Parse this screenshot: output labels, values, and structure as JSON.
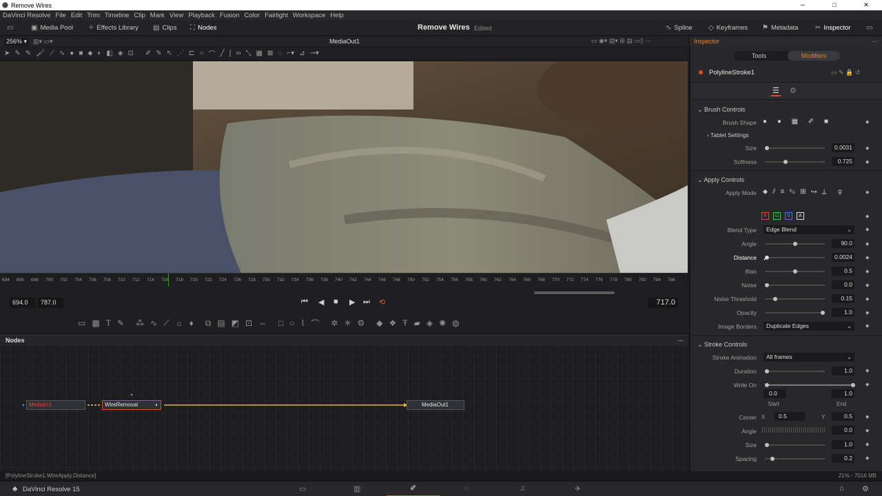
{
  "window": {
    "title": "Remove Wires",
    "controls": [
      "─",
      "□",
      "✕"
    ]
  },
  "menu": [
    "DaVinci Resolve",
    "File",
    "Edit",
    "Trim",
    "Timeline",
    "Clip",
    "Mark",
    "View",
    "Playback",
    "Fusion",
    "Color",
    "Fairlight",
    "Workspace",
    "Help"
  ],
  "toolbar": {
    "media_pool": "Media Pool",
    "effects_library": "Effects Library",
    "clips": "Clips",
    "nodes": "Nodes",
    "project_title": "Remove Wires",
    "project_status": "Edited",
    "spline": "Spline",
    "keyframes": "Keyframes",
    "metadata": "Metadata",
    "inspector": "Inspector"
  },
  "viewer": {
    "zoom": "256%",
    "name": "MediaOut1"
  },
  "ruler": {
    "ticks": [
      "694",
      "696",
      "698",
      "700",
      "702",
      "704",
      "706",
      "708",
      "710",
      "712",
      "714",
      "716",
      "718",
      "720",
      "722",
      "724",
      "726",
      "728",
      "730",
      "732",
      "734",
      "736",
      "738",
      "740",
      "742",
      "744",
      "746",
      "748",
      "750",
      "752",
      "754",
      "756",
      "758",
      "760",
      "762",
      "764",
      "766",
      "768",
      "770",
      "772",
      "774",
      "776",
      "778",
      "780",
      "782",
      "784",
      "786"
    ]
  },
  "transport": {
    "start": "694.0",
    "end": "787.0",
    "current": "717.0"
  },
  "nodes_panel": {
    "title": "Nodes",
    "nodes": [
      {
        "label": "MediaIn1",
        "color": "#d9483b"
      },
      {
        "label": "WireRemoval",
        "color": "#e0e0e0"
      },
      {
        "label": "MediaOut1",
        "color": "#e0e0e0"
      }
    ]
  },
  "status_line": {
    "path": "[PolylineStroke1.WireApply.Distance]",
    "memory": "21% - 7016 MB"
  },
  "bottom": {
    "app_name": "DaVinci Resolve 15"
  },
  "inspector": {
    "header": "Inspector",
    "tabs": {
      "tools": "Tools",
      "modifiers": "Modifiers"
    },
    "tool_name": "PolylineStroke1",
    "brush_controls": {
      "section": "Brush Controls",
      "brush_shape_label": "Brush Shape",
      "tablet_settings": "Tablet Settings",
      "size_label": "Size",
      "size_value": "0.0031",
      "size_level": 0.0,
      "softness_label": "Softness",
      "softness_value": "0.725",
      "softness_level": 0.33
    },
    "apply_controls": {
      "section": "Apply Controls",
      "apply_mode_label": "Apply Mode",
      "channels": [
        "R",
        "G",
        "B",
        "A"
      ],
      "blend_type_label": "Blend Type",
      "blend_type_value": "Edge Blend",
      "angle_label": "Angle",
      "angle_value": "90.0",
      "angle_level": 0.5,
      "distance_label": "Distance",
      "distance_value": "0.0024",
      "distance_level": 0.0,
      "bias_label": "Bias",
      "bias_value": "0.5",
      "bias_level": 0.5,
      "noise_label": "Noise",
      "noise_value": "0.0",
      "noise_level": 0.0,
      "noise_threshold_label": "Noise Threshold",
      "noise_threshold_value": "0.15",
      "noise_threshold_level": 0.15,
      "opacity_label": "Opacity",
      "opacity_value": "1.0",
      "opacity_level": 1.0,
      "image_borders_label": "Image Borders",
      "image_borders_value": "Duplicate Edges"
    },
    "stroke_controls": {
      "section": "Stroke Controls",
      "stroke_animation_label": "Stroke Animation",
      "stroke_animation_value": "All frames",
      "duration_label": "Duration",
      "duration_value": "1.0",
      "duration_level": 0.0,
      "write_on_label": "Write On",
      "write_on_start": "0.0",
      "write_on_end": "1.0",
      "start_label": "Start",
      "end_label": "End",
      "center_label": "Center",
      "center_x_label": "X",
      "center_x": "0.5",
      "center_y_label": "Y",
      "center_y": "0.5",
      "angle_label": "Angle",
      "angle_value": "0.0",
      "size_label": "Size",
      "size_value": "1.0",
      "size_level": 0.0,
      "spacing_label": "Spacing",
      "spacing_value": "0.2",
      "spacing_level": 0.1
    }
  }
}
